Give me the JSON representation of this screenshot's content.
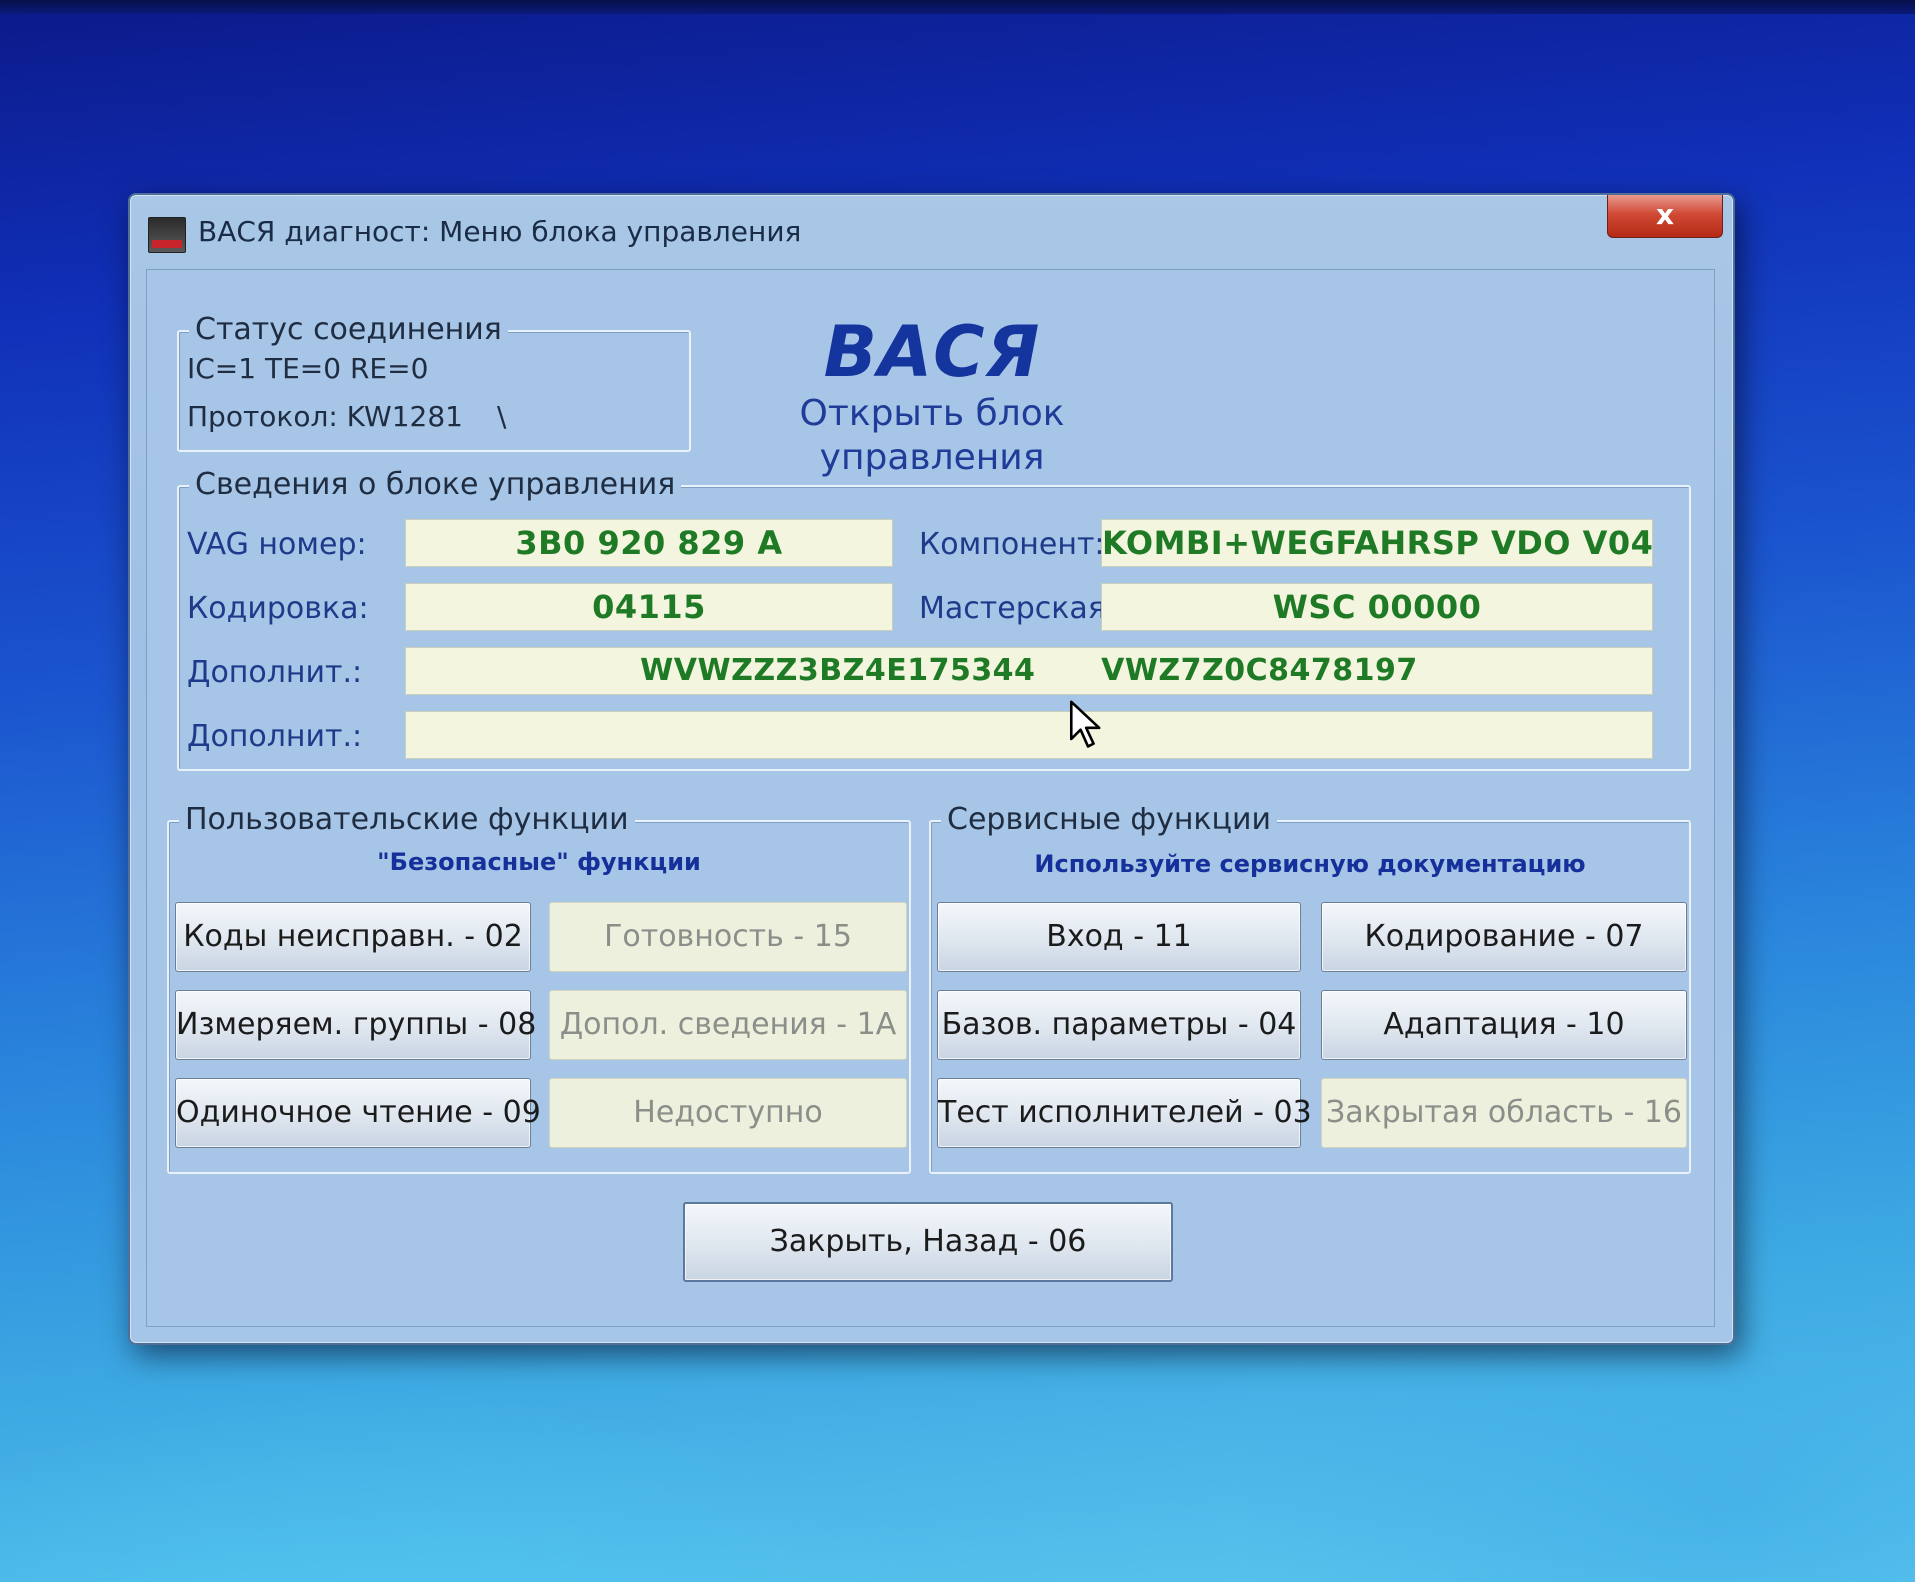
{
  "window": {
    "title": "ВАСЯ диагност: Меню блока управления",
    "close_label": "x"
  },
  "status": {
    "legend": "Статус соединения",
    "line1": "IC=1  TE=0   RE=0",
    "protocol": "Протокол: KW1281",
    "spinner": "\\"
  },
  "brand": {
    "title": "ВАСЯ",
    "subtitle_line1": "Открыть блок",
    "subtitle_line2": "управления"
  },
  "info": {
    "legend": "Сведения о блоке управления",
    "vag_label": "VAG номер:",
    "vag_value": "3B0 920 829 A",
    "component_label": "Компонент:",
    "component_value": "KOMBI+WEGFAHRSP VDO V04",
    "coding_label": "Кодировка:",
    "coding_value": "04115",
    "workshop_label": "Мастерская:",
    "workshop_value": "WSC 00000",
    "extra1_label": "Дополнит.:",
    "extra1_value": "WVWZZZ3BZ4E175344      VWZ7Z0C8478197",
    "extra2_label": "Дополнит.:",
    "extra2_value": ""
  },
  "user_functions": {
    "legend": "Пользовательские функции",
    "caption": "\"Безопасные\" функции",
    "buttons": [
      "Коды неисправн. - 02",
      "Готовность - 15",
      "Измеряем. группы - 08",
      "Допол. сведения - 1A",
      "Одиночное чтение - 09",
      "Недоступно"
    ]
  },
  "service_functions": {
    "legend": "Сервисные функции",
    "caption": "Используйте сервисную документацию",
    "buttons": [
      "Вход - 11",
      "Кодирование - 07",
      "Базов. параметры - 04",
      "Адаптация - 10",
      "Тест исполнителей - 03",
      "Закрытая область - 16"
    ]
  },
  "footer": {
    "close_back": "Закрыть, Назад - 06"
  },
  "colors": {
    "value_text": "#1f7a26",
    "label_text": "#1f3a8a",
    "field_bg": "#f4f5df",
    "close_red": "#c7351f"
  }
}
